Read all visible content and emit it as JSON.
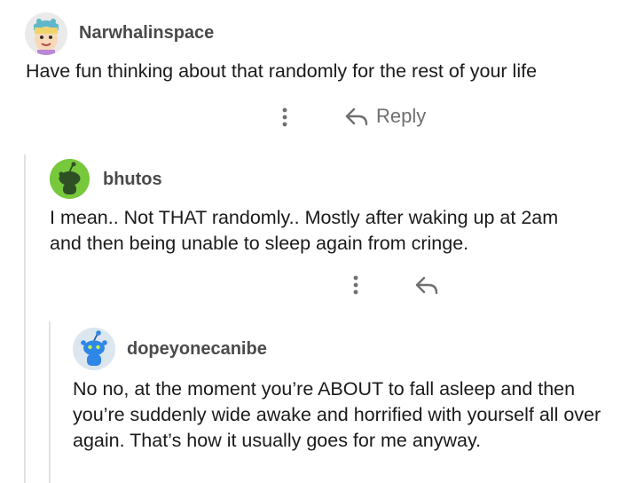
{
  "comments": [
    {
      "username": "Narwhalinspace",
      "body": "Have fun thinking about that randomly for the rest of your life",
      "reply_label": "Reply"
    },
    {
      "username": "bhutos",
      "body": "I mean.. Not THAT randomly.. Mostly after waking up at 2am and then being unable to sleep again from cringe."
    },
    {
      "username": "dopeyonecanibe",
      "body": "No no, at the moment you’re ABOUT to fall asleep and then you’re suddenly wide awake and horrified with yourself all over again. That’s how it usually goes for me anyway."
    }
  ],
  "icons": {
    "more": "more-vertical-icon",
    "reply": "reply-arrow-icon"
  },
  "colors": {
    "avatar1_bg": "#ececec",
    "avatar2_bg": "#78c83c",
    "avatar3_bg": "#dbe6ef",
    "snoo_blue": "#2e86e6",
    "thread_line": "#e2e2e2"
  }
}
